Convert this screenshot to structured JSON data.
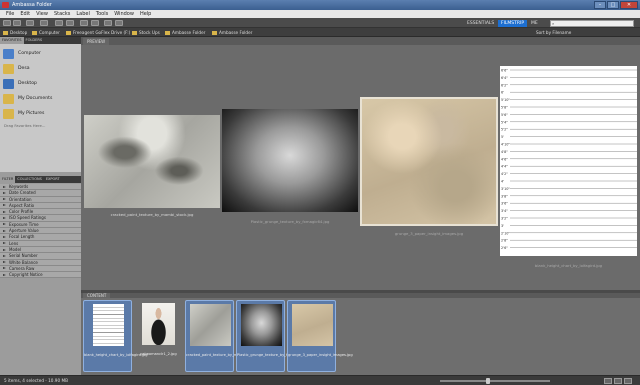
{
  "window": {
    "title": "Ambassa Folder",
    "controls": [
      "–",
      "□",
      "✕"
    ]
  },
  "menu": [
    "File",
    "Edit",
    "View",
    "Stacks",
    "Label",
    "Tools",
    "Window",
    "Help"
  ],
  "toolbar": {
    "workspace_tabs": [
      "ESSENTIALS",
      "FILMSTRIP",
      "ME"
    ],
    "active_workspace": "FILMSTRIP",
    "search_placeholder": ""
  },
  "path": {
    "crumbs": [
      "Desktop",
      "Computer",
      "Freeagent GoFlex Drive (F:)",
      "Stock Ups",
      "Ambasse Folder",
      "Ambasse Folder"
    ],
    "sort_label": "Sort by Filename"
  },
  "left_panel": {
    "tabs": [
      "FAVORITES",
      "FOLDERS"
    ],
    "favorites": [
      {
        "label": "Computer",
        "color": "#4a7fc9"
      },
      {
        "label": "Desa",
        "color": "#d9b54a"
      },
      {
        "label": "Desktop",
        "color": "#3a6fb8"
      },
      {
        "label": "My Documents",
        "color": "#d9b54a"
      },
      {
        "label": "My Pictures",
        "color": "#d9b54a"
      }
    ],
    "drag_hint": "Drag Favorites Here...",
    "filter_tabs": [
      "FILTER",
      "COLLECTIONS",
      "EXPORT"
    ],
    "filters": [
      "Keywords",
      "Date Created",
      "Orientation",
      "Aspect Ratio",
      "Color Profile",
      "ISO Speed Ratings",
      "Exposure Time",
      "Aperture Value",
      "Focal Length",
      "Lens",
      "Model",
      "Serial Number",
      "White Balance",
      "Camera Raw",
      "Copyright Notice"
    ]
  },
  "preview": {
    "tab": "PREVIEW",
    "items": [
      {
        "caption": "cracked_paint_texture_by_mambi_stock.jpg"
      },
      {
        "caption": "Plastic_grunge_texture_by_fxmagic64.jpg"
      },
      {
        "caption": "grunge_3_paper_insight_images.jpg"
      },
      {
        "caption": "blank_height_chart_by_lolfagird.jpg"
      }
    ],
    "chart_ticks": [
      "6'6\"",
      "6'4\"",
      "6'2\"",
      "6'",
      "5'10\"",
      "5'8\"",
      "5'6\"",
      "5'4\"",
      "5'2\"",
      "5'",
      "4'10\"",
      "4'8\"",
      "4'6\"",
      "4'4\"",
      "4'2\"",
      "4'",
      "3'10\"",
      "3'8\"",
      "3'6\"",
      "3'4\"",
      "3'2\"",
      "3'",
      "2'10\"",
      "2'8\"",
      "2'6\""
    ]
  },
  "content": {
    "tab": "CONTENT",
    "thumbs": [
      {
        "caption": "blank_height_chart_by_lolfagird.jpg",
        "selected": true
      },
      {
        "caption": "catwomanclr1_2.jpg",
        "selected": false
      },
      {
        "caption": "cracked_paint_texture_by_mambi_stock.jpg",
        "selected": true
      },
      {
        "caption": "Plastic_grunge_texture_by_fxmagic64.jpg",
        "selected": true
      },
      {
        "caption": "grunge_3_paper_insight_images.jpg",
        "selected": true
      }
    ]
  },
  "status": {
    "text": "5 items, 4 selected - 10.90 MB"
  }
}
